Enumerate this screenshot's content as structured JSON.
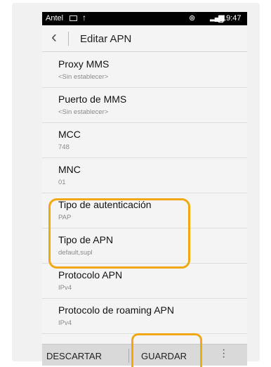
{
  "status_bar": {
    "carrier": "Antel",
    "time": "19:47"
  },
  "app_bar": {
    "title": "Editar APN"
  },
  "settings": [
    {
      "name": "Proxy MMS",
      "value": "<Sin establecer>"
    },
    {
      "name": "Puerto de MMS",
      "value": "<Sin establecer>"
    },
    {
      "name": "MCC",
      "value": "748"
    },
    {
      "name": "MNC",
      "value": "01"
    },
    {
      "name": "Tipo de autenticación",
      "value": "PAP"
    },
    {
      "name": "Tipo de APN",
      "value": "default,supl"
    },
    {
      "name": "Protocolo APN",
      "value": "IPv4"
    },
    {
      "name": "Protocolo de roaming APN",
      "value": "IPv4"
    }
  ],
  "bottom_bar": {
    "discard_label": "DESCARTAR",
    "save_label": "GUARDAR"
  },
  "highlight_color": "#f3a712",
  "icons": {
    "back": "back-chevron-icon",
    "more": "more-vert-icon",
    "upload": "upload-icon",
    "vibrate": "vibrate-icon",
    "signal": "signal-icon",
    "battery": "battery-icon",
    "image": "image-notification-icon"
  }
}
